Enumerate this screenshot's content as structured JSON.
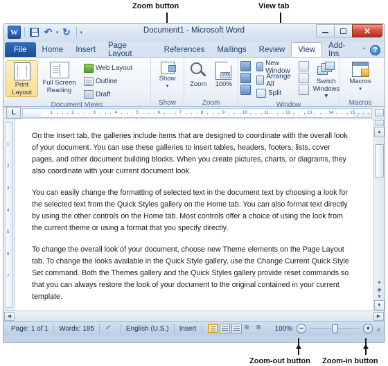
{
  "annotations": [
    {
      "label": "Zoom button",
      "name": "annotation-zoom-button"
    },
    {
      "label": "View tab",
      "name": "annotation-view-tab"
    },
    {
      "label": "Zoom-out button",
      "name": "annotation-zoom-out-button"
    },
    {
      "label": "Zoom-in button",
      "name": "annotation-zoom-in-button"
    }
  ],
  "window": {
    "title": "Document1 - Microsoft Word",
    "quick_access": {
      "app_icon": "word-logo-icon",
      "save": "save-icon",
      "undo": "undo-icon",
      "redo": "redo-icon",
      "customize": "customize-qat-icon"
    },
    "controls": {
      "minimize": "minimize-icon",
      "restore": "restore-icon",
      "close": "✕"
    }
  },
  "tabs": [
    {
      "label": "File",
      "active": false,
      "kind": "file"
    },
    {
      "label": "Home",
      "active": false
    },
    {
      "label": "Insert",
      "active": false
    },
    {
      "label": "Page Layout",
      "active": false
    },
    {
      "label": "References",
      "active": false
    },
    {
      "label": "Mailings",
      "active": false
    },
    {
      "label": "Review",
      "active": false
    },
    {
      "label": "View",
      "active": true
    },
    {
      "label": "Add-Ins",
      "active": false
    }
  ],
  "tab_right": {
    "collapse_ribbon": "chevron-up-icon",
    "help": "?"
  },
  "ribbon": {
    "groups": [
      {
        "label": "Document Views",
        "big_buttons": [
          {
            "label_line1": "Print",
            "label_line2": "Layout",
            "selected": true,
            "icon": "print-layout-icon"
          },
          {
            "label_line1": "Full Screen",
            "label_line2": "Reading",
            "selected": false,
            "icon": "full-screen-reading-icon"
          }
        ],
        "small_buttons": [
          {
            "label": "Web Layout",
            "icon": "web-layout-icon"
          },
          {
            "label": "Outline",
            "icon": "outline-icon"
          },
          {
            "label": "Draft",
            "icon": "draft-icon"
          }
        ]
      },
      {
        "label": "Show",
        "big_buttons": [
          {
            "label_line1": "Show",
            "label_line2": "▾",
            "selected": false,
            "icon": "show-icon"
          }
        ]
      },
      {
        "label": "Zoom",
        "big_buttons": [
          {
            "label_line1": "Zoom",
            "label_line2": "",
            "selected": false,
            "icon": "zoom-magnifier-icon"
          },
          {
            "label_line1": "100%",
            "label_line2": "",
            "selected": false,
            "icon": "zoom-100-percent-icon"
          }
        ]
      },
      {
        "label": "Window",
        "small_buttons": [
          {
            "label": "New Window",
            "icon": "new-window-icon"
          },
          {
            "label": "Arrange All",
            "icon": "arrange-all-icon"
          },
          {
            "label": "Split",
            "icon": "split-icon"
          }
        ],
        "big_buttons": [
          {
            "label_line1": "Switch",
            "label_line2": "Windows ▾",
            "selected": false,
            "icon": "switch-windows-icon"
          }
        ]
      },
      {
        "label": "Macros",
        "big_buttons": [
          {
            "label_line1": "Macros",
            "label_line2": "▾",
            "selected": false,
            "icon": "macros-icon"
          }
        ]
      }
    ]
  },
  "ruler": {
    "tab_selector": "L",
    "h_ticks": [
      "1",
      "2",
      "3",
      "4",
      "5",
      "6",
      "7",
      "8",
      "9",
      "10",
      "11",
      "12",
      "13",
      "14",
      "15"
    ],
    "v_ticks": [
      "1",
      "2",
      "3",
      "4",
      "5",
      "6",
      "7"
    ]
  },
  "document": {
    "paragraphs": [
      "On the Insert tab, the galleries include items that are designed to coordinate with the overall look of your document. You can use these galleries to insert tables, headers, footers, lists, cover pages, and other document building blocks. When you create pictures, charts, or diagrams, they also coordinate with your current document look.",
      "You can easily change the formatting of selected text in the document text by choosing a look for the selected text from the Quick Styles gallery on the Home tab. You can also format text directly by using the other controls on the Home tab. Most controls offer a choice of using the look from the current theme or using a format that you specify directly.",
      "To change the overall look of your document, choose new Theme elements on the Page Layout tab. To change the looks available in the Quick Style gallery, use the Change Current Quick Style Set command. Both the Themes gallery and the Quick Styles gallery provide reset commands so that you can always restore the look of your document to the original contained in your current template."
    ]
  },
  "status_bar": {
    "page": "Page: 1 of 1",
    "words": "Words: 185",
    "proofing_icon": "spell-check-icon",
    "language": "English (U.S.)",
    "insert_mode": "Insert",
    "view_buttons": [
      {
        "name": "print-layout-view-icon",
        "selected": true
      },
      {
        "name": "full-screen-reading-view-icon",
        "selected": false
      },
      {
        "name": "web-layout-view-icon",
        "selected": false
      },
      {
        "name": "outline-view-icon",
        "selected": false
      },
      {
        "name": "draft-view-icon",
        "selected": false
      }
    ],
    "zoom_level": "100%",
    "zoom_out": "−",
    "zoom_in": "+"
  }
}
